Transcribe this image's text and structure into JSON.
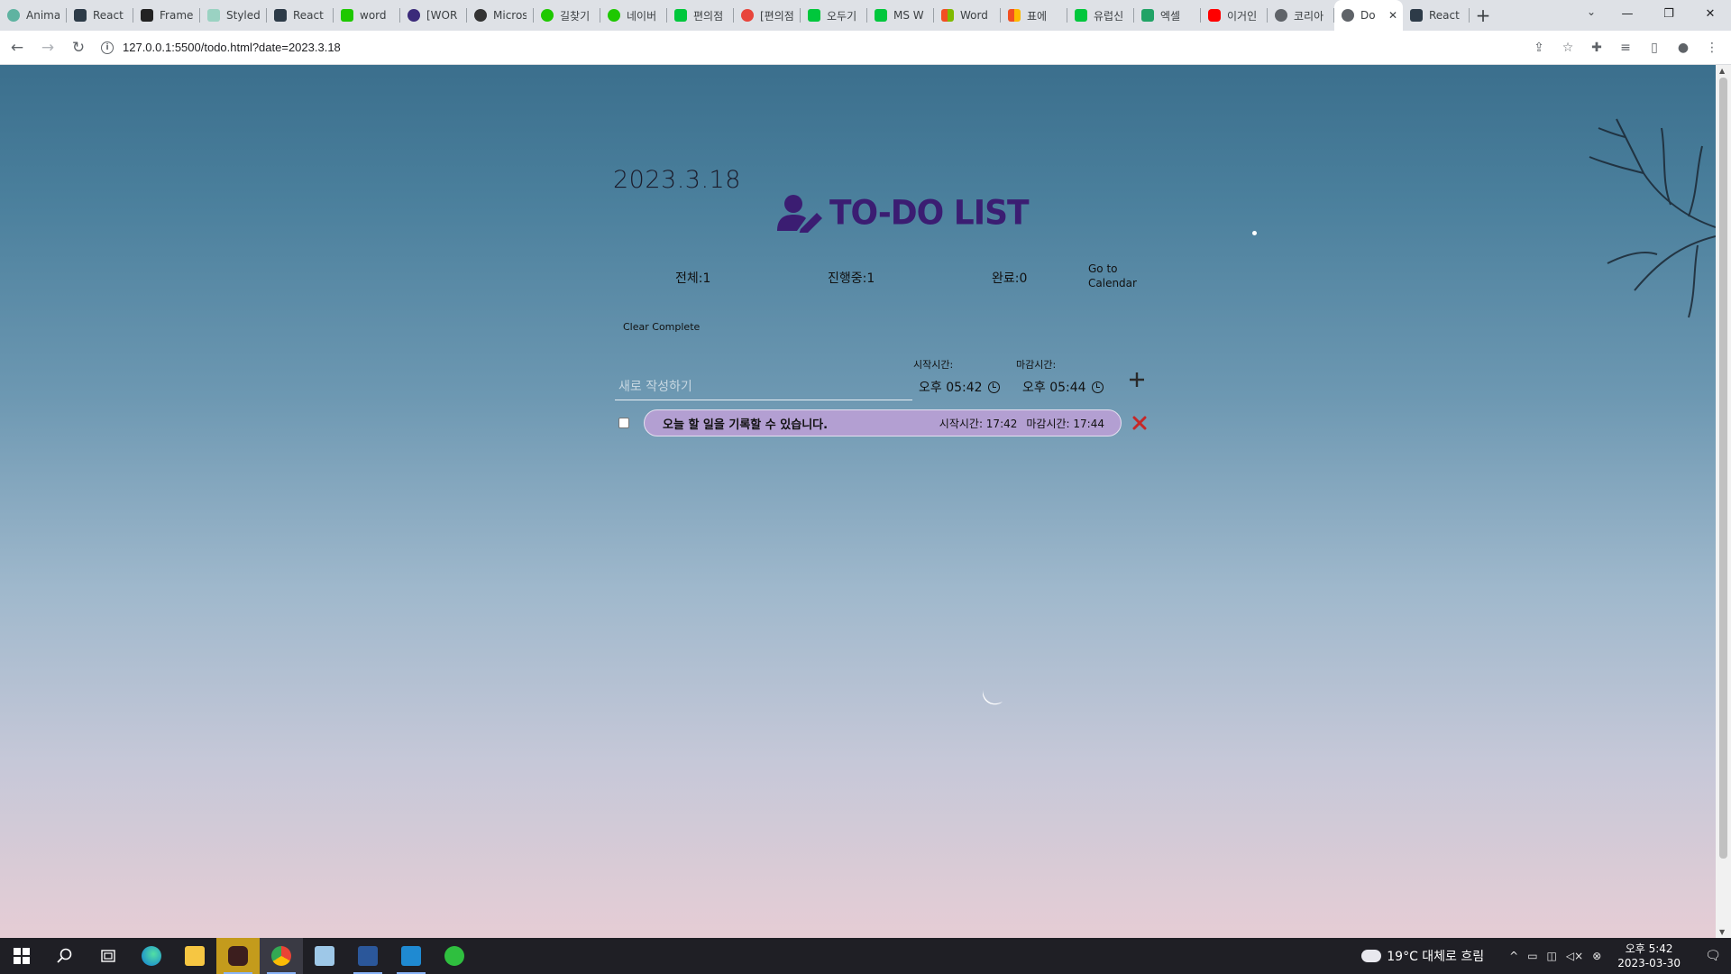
{
  "browser": {
    "tabs": [
      {
        "label": "Anima",
        "color": "#5fb3a1"
      },
      {
        "label": "React",
        "color": "#2d3b48"
      },
      {
        "label": "Frame",
        "color": "#222222"
      },
      {
        "label": "Styled",
        "color": "#9ad2c2"
      },
      {
        "label": "React",
        "color": "#2d3b48"
      },
      {
        "label": "word",
        "color": "#1ec800"
      },
      {
        "label": "[WOR",
        "color": "#3b2a7a"
      },
      {
        "label": "Micros",
        "color": "#333333"
      },
      {
        "label": "길찾기",
        "color": "#1ec800"
      },
      {
        "label": "네이버",
        "color": "#1ec800"
      },
      {
        "label": "편의점",
        "color": "#00c73c"
      },
      {
        "label": "[편의점",
        "color": "#e8453c"
      },
      {
        "label": "오두기",
        "color": "#00c73c"
      },
      {
        "label": "MS W",
        "color": "#00c73c"
      },
      {
        "label": "Word",
        "color": "#f25022"
      },
      {
        "label": "표에 ",
        "color": "#f25022"
      },
      {
        "label": "유럽신",
        "color": "#00c73c"
      },
      {
        "label": "엑셀 ",
        "color": "#21a366"
      },
      {
        "label": "이거인",
        "color": "#ff0000"
      },
      {
        "label": "코리아",
        "color": "#5f6368"
      },
      {
        "label": "Do",
        "color": "#5f6368"
      },
      {
        "label": "React",
        "color": "#2d3b48"
      }
    ],
    "active_tab_close": "✕",
    "new_tab": "+",
    "url": "127.0.0.1:5500/todo.html?date=2023.3.18"
  },
  "page": {
    "date": "2023.3.18",
    "title": "TO-DO LIST",
    "stats": {
      "all": "전체:1",
      "in_progress": "진행중:1",
      "done": "완료:0"
    },
    "go_calendar": "Go to Calendar",
    "clear_complete": "Clear Complete",
    "new_input": {
      "placeholder": "새로 작성하기",
      "value": ""
    },
    "start_label": "시작시간:",
    "end_label": "마감시간:",
    "start_time": "오후 05:42",
    "end_time": "오후 05:44",
    "todos": [
      {
        "text": "오늘 할 일을 기록할 수 있습니다.",
        "start": "시작시간: 17:42",
        "end": "마감시간: 17:44",
        "checked": false
      }
    ],
    "colors": {
      "title": "#3b1d72",
      "todo_pill": "#b39fd2",
      "delete_icon": "#c62828"
    }
  },
  "taskbar": {
    "weather": "19°C 대체로 흐림",
    "time": "오후 5:42",
    "date": "2023-03-30"
  }
}
